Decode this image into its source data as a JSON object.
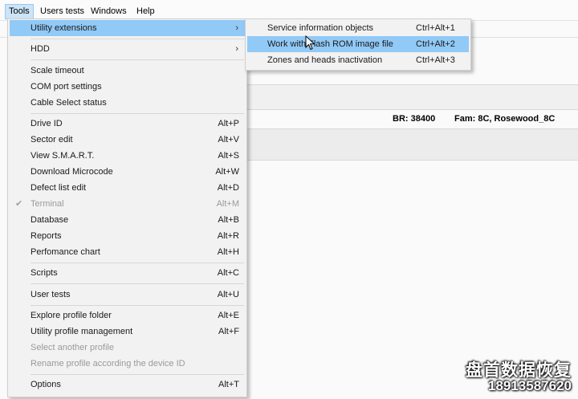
{
  "menubar": {
    "items": [
      {
        "label": "Tools",
        "active": true
      },
      {
        "label": "Users tests"
      },
      {
        "label": "Windows"
      },
      {
        "label": "Help"
      }
    ]
  },
  "background": {
    "br_label": "BR: 38400",
    "fam_label": "Fam: 8C, Rosewood_8C"
  },
  "tools_menu": {
    "items": [
      {
        "label": "Utility extensions",
        "shortcut": "",
        "submenu": true,
        "highlighted": true
      },
      {
        "label": "HDD",
        "shortcut": "",
        "submenu": true
      },
      {
        "label": "Scale timeout",
        "shortcut": ""
      },
      {
        "label": "COM port settings",
        "shortcut": ""
      },
      {
        "label": "Cable Select status",
        "shortcut": ""
      },
      {
        "label": "Drive ID",
        "shortcut": "Alt+P"
      },
      {
        "label": "Sector edit",
        "shortcut": "Alt+V"
      },
      {
        "label": "View S.M.A.R.T.",
        "shortcut": "Alt+S"
      },
      {
        "label": "Download Microcode",
        "shortcut": "Alt+W"
      },
      {
        "label": "Defect list edit",
        "shortcut": "Alt+D"
      },
      {
        "label": "Terminal",
        "shortcut": "Alt+M",
        "disabled": true,
        "checked": true
      },
      {
        "label": "Database",
        "shortcut": "Alt+B"
      },
      {
        "label": "Reports",
        "shortcut": "Alt+R"
      },
      {
        "label": "Perfomance chart",
        "shortcut": "Alt+H"
      },
      {
        "label": "Scripts",
        "shortcut": "Alt+C"
      },
      {
        "label": "User tests",
        "shortcut": "Alt+U"
      },
      {
        "label": "Explore profile folder",
        "shortcut": "Alt+E"
      },
      {
        "label": "Utility profile management",
        "shortcut": "Alt+F"
      },
      {
        "label": "Select another profile",
        "shortcut": "",
        "disabled": true
      },
      {
        "label": "Rename profile according the device ID",
        "shortcut": "",
        "disabled": true
      },
      {
        "label": "Options",
        "shortcut": "Alt+T"
      }
    ]
  },
  "utility_submenu": {
    "items": [
      {
        "label": "Service information objects",
        "shortcut": "Ctrl+Alt+1"
      },
      {
        "label": "Work with Flash ROM image file",
        "shortcut": "Ctrl+Alt+2",
        "highlighted": true
      },
      {
        "label": "Zones and heads inactivation",
        "shortcut": "Ctrl+Alt+3"
      }
    ]
  },
  "watermark": {
    "line1": "盘首数据恢复",
    "line2": "18913587620"
  },
  "colors": {
    "highlight": "#91c9f7",
    "menu_bg": "#f2f2f2",
    "disabled_text": "#9a9a9a"
  },
  "icons": {
    "submenu_arrow": "chevron-right-icon",
    "check": "check-icon",
    "cursor": "mouse-pointer-icon"
  }
}
